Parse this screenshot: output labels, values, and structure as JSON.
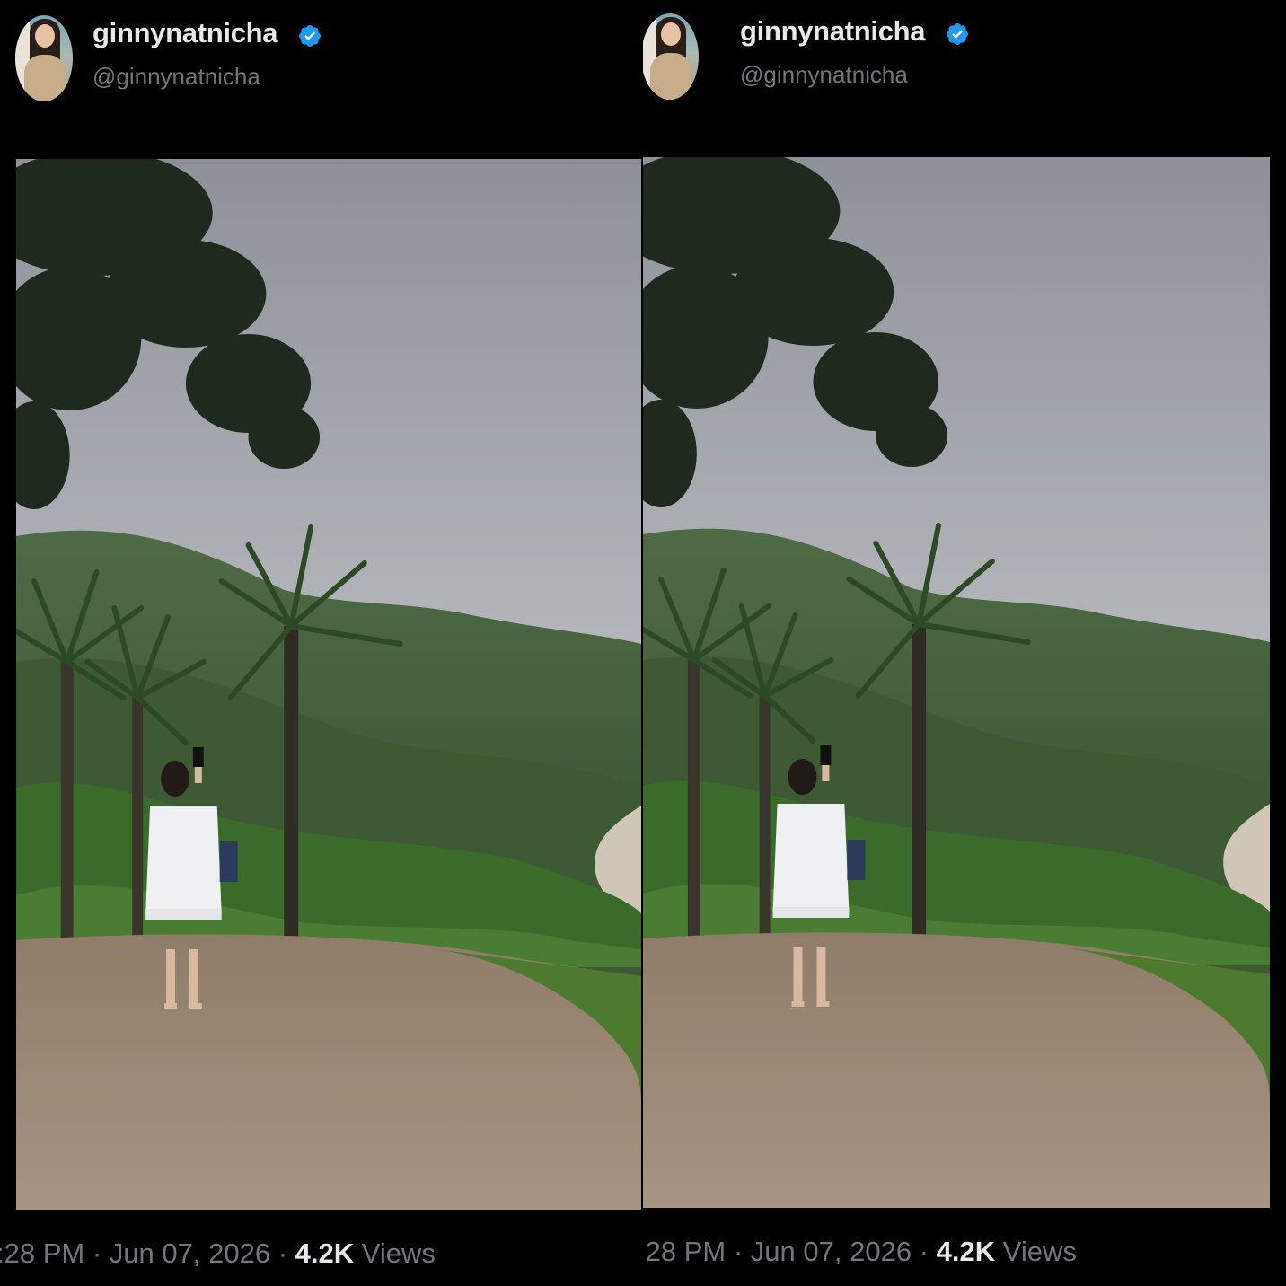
{
  "posts": [
    {
      "display_name": "ginnynatnicha",
      "handle": "@ginnynatnicha",
      "verified": true,
      "time": ":28 PM",
      "dot": "·",
      "date": "Jun 07, 2026",
      "views_count": "4.2K",
      "views_label": "Views",
      "icons": {
        "verified": "verified-badge-icon",
        "avatar": "profile-avatar"
      }
    },
    {
      "display_name": "ginnynatnicha",
      "handle": "@ginnynatnicha",
      "verified": true,
      "time": ":28 PM",
      "dot": "·",
      "date": "Jun 07, 2026",
      "views_count": "4.2K",
      "views_label": "Views",
      "icons": {
        "verified": "verified-badge-icon",
        "avatar": "profile-avatar"
      }
    }
  ],
  "colors": {
    "background": "#000000",
    "name": "#e7e9ea",
    "secondary": "#71767b",
    "verified_blue": "#1d9bf0"
  }
}
